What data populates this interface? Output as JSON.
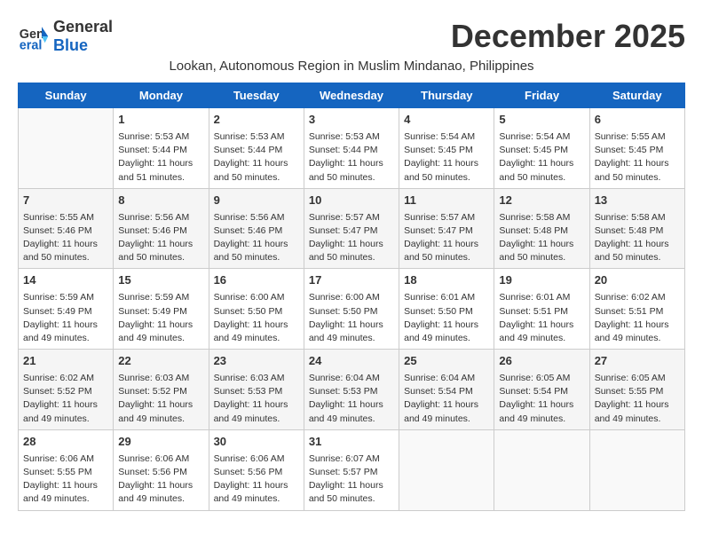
{
  "logo": {
    "line1": "General",
    "line2": "Blue"
  },
  "title": "December 2025",
  "subtitle": "Lookan, Autonomous Region in Muslim Mindanao, Philippines",
  "days_of_week": [
    "Sunday",
    "Monday",
    "Tuesday",
    "Wednesday",
    "Thursday",
    "Friday",
    "Saturday"
  ],
  "weeks": [
    [
      {
        "day": "",
        "info": ""
      },
      {
        "day": "1",
        "info": "Sunrise: 5:53 AM\nSunset: 5:44 PM\nDaylight: 11 hours\nand 51 minutes."
      },
      {
        "day": "2",
        "info": "Sunrise: 5:53 AM\nSunset: 5:44 PM\nDaylight: 11 hours\nand 50 minutes."
      },
      {
        "day": "3",
        "info": "Sunrise: 5:53 AM\nSunset: 5:44 PM\nDaylight: 11 hours\nand 50 minutes."
      },
      {
        "day": "4",
        "info": "Sunrise: 5:54 AM\nSunset: 5:45 PM\nDaylight: 11 hours\nand 50 minutes."
      },
      {
        "day": "5",
        "info": "Sunrise: 5:54 AM\nSunset: 5:45 PM\nDaylight: 11 hours\nand 50 minutes."
      },
      {
        "day": "6",
        "info": "Sunrise: 5:55 AM\nSunset: 5:45 PM\nDaylight: 11 hours\nand 50 minutes."
      }
    ],
    [
      {
        "day": "7",
        "info": "Sunrise: 5:55 AM\nSunset: 5:46 PM\nDaylight: 11 hours\nand 50 minutes."
      },
      {
        "day": "8",
        "info": "Sunrise: 5:56 AM\nSunset: 5:46 PM\nDaylight: 11 hours\nand 50 minutes."
      },
      {
        "day": "9",
        "info": "Sunrise: 5:56 AM\nSunset: 5:46 PM\nDaylight: 11 hours\nand 50 minutes."
      },
      {
        "day": "10",
        "info": "Sunrise: 5:57 AM\nSunset: 5:47 PM\nDaylight: 11 hours\nand 50 minutes."
      },
      {
        "day": "11",
        "info": "Sunrise: 5:57 AM\nSunset: 5:47 PM\nDaylight: 11 hours\nand 50 minutes."
      },
      {
        "day": "12",
        "info": "Sunrise: 5:58 AM\nSunset: 5:48 PM\nDaylight: 11 hours\nand 50 minutes."
      },
      {
        "day": "13",
        "info": "Sunrise: 5:58 AM\nSunset: 5:48 PM\nDaylight: 11 hours\nand 50 minutes."
      }
    ],
    [
      {
        "day": "14",
        "info": "Sunrise: 5:59 AM\nSunset: 5:49 PM\nDaylight: 11 hours\nand 49 minutes."
      },
      {
        "day": "15",
        "info": "Sunrise: 5:59 AM\nSunset: 5:49 PM\nDaylight: 11 hours\nand 49 minutes."
      },
      {
        "day": "16",
        "info": "Sunrise: 6:00 AM\nSunset: 5:50 PM\nDaylight: 11 hours\nand 49 minutes."
      },
      {
        "day": "17",
        "info": "Sunrise: 6:00 AM\nSunset: 5:50 PM\nDaylight: 11 hours\nand 49 minutes."
      },
      {
        "day": "18",
        "info": "Sunrise: 6:01 AM\nSunset: 5:50 PM\nDaylight: 11 hours\nand 49 minutes."
      },
      {
        "day": "19",
        "info": "Sunrise: 6:01 AM\nSunset: 5:51 PM\nDaylight: 11 hours\nand 49 minutes."
      },
      {
        "day": "20",
        "info": "Sunrise: 6:02 AM\nSunset: 5:51 PM\nDaylight: 11 hours\nand 49 minutes."
      }
    ],
    [
      {
        "day": "21",
        "info": "Sunrise: 6:02 AM\nSunset: 5:52 PM\nDaylight: 11 hours\nand 49 minutes."
      },
      {
        "day": "22",
        "info": "Sunrise: 6:03 AM\nSunset: 5:52 PM\nDaylight: 11 hours\nand 49 minutes."
      },
      {
        "day": "23",
        "info": "Sunrise: 6:03 AM\nSunset: 5:53 PM\nDaylight: 11 hours\nand 49 minutes."
      },
      {
        "day": "24",
        "info": "Sunrise: 6:04 AM\nSunset: 5:53 PM\nDaylight: 11 hours\nand 49 minutes."
      },
      {
        "day": "25",
        "info": "Sunrise: 6:04 AM\nSunset: 5:54 PM\nDaylight: 11 hours\nand 49 minutes."
      },
      {
        "day": "26",
        "info": "Sunrise: 6:05 AM\nSunset: 5:54 PM\nDaylight: 11 hours\nand 49 minutes."
      },
      {
        "day": "27",
        "info": "Sunrise: 6:05 AM\nSunset: 5:55 PM\nDaylight: 11 hours\nand 49 minutes."
      }
    ],
    [
      {
        "day": "28",
        "info": "Sunrise: 6:06 AM\nSunset: 5:55 PM\nDaylight: 11 hours\nand 49 minutes."
      },
      {
        "day": "29",
        "info": "Sunrise: 6:06 AM\nSunset: 5:56 PM\nDaylight: 11 hours\nand 49 minutes."
      },
      {
        "day": "30",
        "info": "Sunrise: 6:06 AM\nSunset: 5:56 PM\nDaylight: 11 hours\nand 49 minutes."
      },
      {
        "day": "31",
        "info": "Sunrise: 6:07 AM\nSunset: 5:57 PM\nDaylight: 11 hours\nand 50 minutes."
      },
      {
        "day": "",
        "info": ""
      },
      {
        "day": "",
        "info": ""
      },
      {
        "day": "",
        "info": ""
      }
    ]
  ]
}
